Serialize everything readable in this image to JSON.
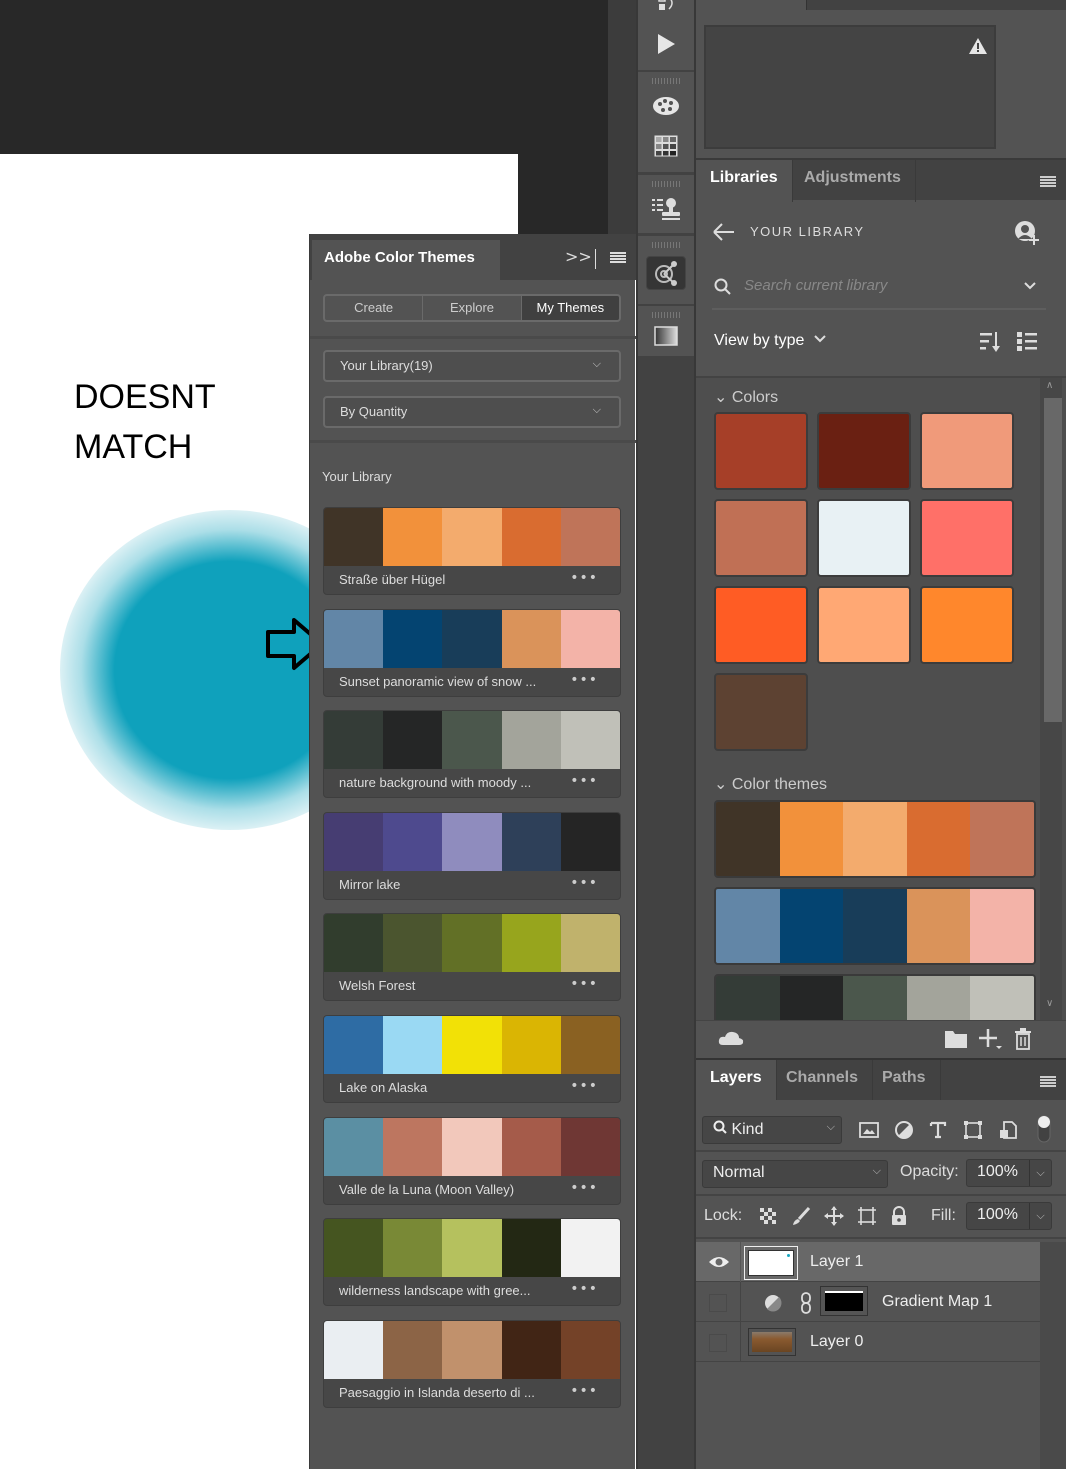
{
  "annotation": {
    "line1": "DOESNT",
    "line2": "MATCH"
  },
  "act_panel": {
    "title": "Adobe Color Themes",
    "expand_glyph": ">>",
    "tabs": [
      {
        "label": "Create"
      },
      {
        "label": "Explore"
      },
      {
        "label": "My Themes",
        "active": true
      }
    ],
    "library_select": "Your Library(19)",
    "sort_select": "By Quantity",
    "section_label": "Your Library",
    "more_glyph": "•••",
    "themes": [
      {
        "name": "Straße über Hügel",
        "colors": [
          "#403427",
          "#f2913b",
          "#f3ab6d",
          "#d96c30",
          "#bf7459"
        ]
      },
      {
        "name": "Sunset panoramic view of snow ...",
        "colors": [
          "#6286a7",
          "#044471",
          "#183d59",
          "#da935a",
          "#f3b3a8"
        ]
      },
      {
        "name": "nature background with moody ...",
        "colors": [
          "#343c37",
          "#252626",
          "#4b574c",
          "#a3a49b",
          "#c0c0b8"
        ]
      },
      {
        "name": "Mirror lake",
        "colors": [
          "#463d72",
          "#4e4a8e",
          "#8f8cbe",
          "#2e4059",
          "#252525"
        ]
      },
      {
        "name": "Welsh Forest",
        "colors": [
          "#313d2d",
          "#4b552f",
          "#627026",
          "#97a51d",
          "#c0b26c"
        ]
      },
      {
        "name": "Lake on Alaska",
        "colors": [
          "#2e6ca4",
          "#9ad9f3",
          "#f2e106",
          "#dab503",
          "#8a6122"
        ]
      },
      {
        "name": "Valle de la Luna (Moon Valley)",
        "colors": [
          "#5b8fa3",
          "#bd7660",
          "#f2c8bb",
          "#a55b4a",
          "#6f3734"
        ]
      },
      {
        "name": "wilderness landscape with gree...",
        "colors": [
          "#455520",
          "#798936",
          "#b5c15e",
          "#232814",
          "#f2f2f2"
        ]
      },
      {
        "name": "Paesaggio in Islanda deserto di ...",
        "colors": [
          "#eaeef2",
          "#8c6446",
          "#c1916c",
          "#412515",
          "#744228"
        ]
      }
    ]
  },
  "libraries_panel": {
    "tabs": [
      {
        "label": "Libraries",
        "active": true
      },
      {
        "label": "Adjustments"
      }
    ],
    "header_title": "YOUR LIBRARY",
    "search_placeholder": "Search current library",
    "view_by": "View by type",
    "colors_section": "Colors",
    "colors": [
      "#a63f28",
      "#6a2012",
      "#f09a7a",
      "#c07055",
      "#e8f1f4",
      "#ff7068",
      "#ff5c24",
      "#ffa874",
      "#ff872c",
      "#5d4232"
    ],
    "themes_section": "Color themes",
    "themes": [
      [
        "#403427",
        "#f2913b",
        "#f3ab6d",
        "#d96c30",
        "#bf7459"
      ],
      [
        "#6286a7",
        "#044471",
        "#183d59",
        "#da935a",
        "#f3b3a8"
      ],
      [
        "#343c37",
        "#252626",
        "#4b574c",
        "#a3a49b",
        "#c0c0b8"
      ]
    ]
  },
  "layers_panel": {
    "tabs": [
      {
        "label": "Layers",
        "active": true
      },
      {
        "label": "Channels"
      },
      {
        "label": "Paths"
      }
    ],
    "filter_kind": "Kind",
    "blend_mode": "Normal",
    "opacity_label": "Opacity:",
    "opacity_value": "100%",
    "lock_label": "Lock:",
    "fill_label": "Fill:",
    "fill_value": "100%",
    "layers": [
      {
        "name": "Layer 1",
        "visible": true,
        "selected": true
      },
      {
        "name": "Gradient Map 1",
        "visible": false,
        "type": "adjustment"
      },
      {
        "name": "Layer 0",
        "visible": false
      }
    ]
  }
}
